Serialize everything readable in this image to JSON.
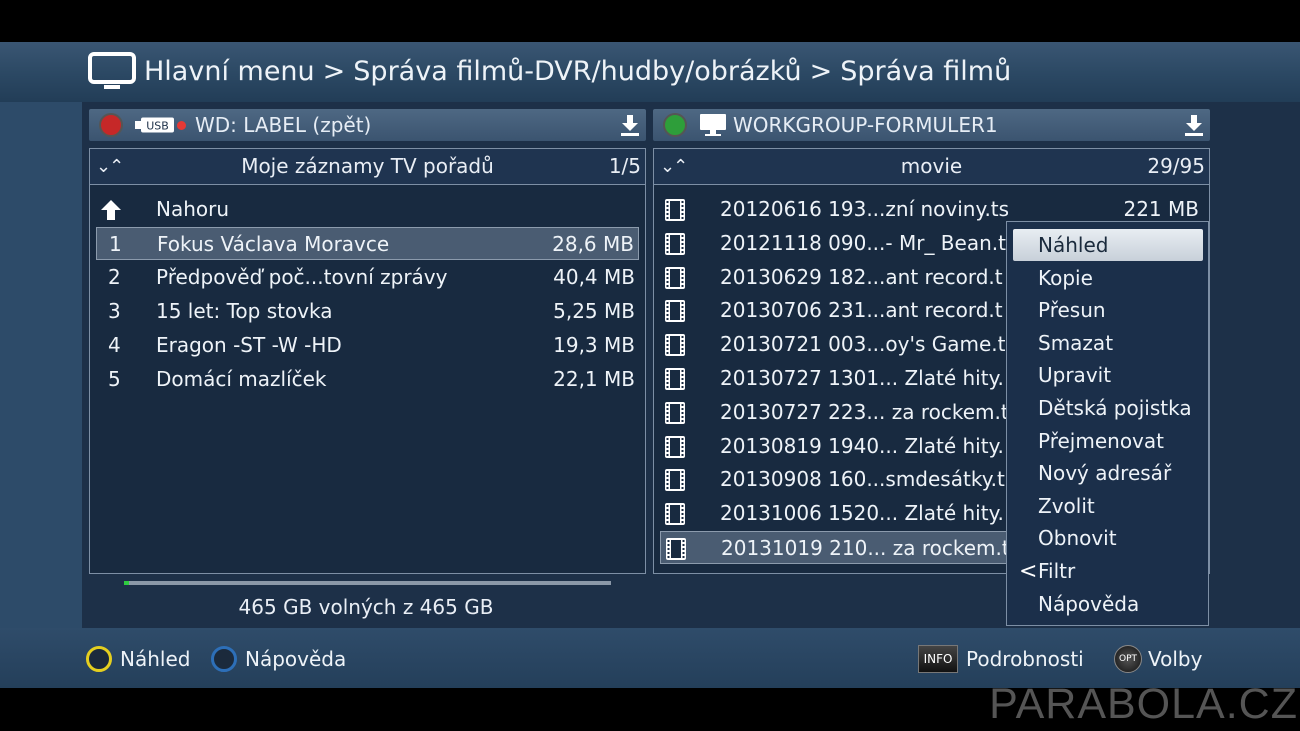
{
  "header": {
    "crumbs": [
      "Hlavní menu",
      "Správa filmů-DVR/hudby/obrázků",
      "Správa filmů"
    ],
    "separator": ">",
    "icon": "tv-icon"
  },
  "left_panel": {
    "device_badge": "USB",
    "title": "WD: LABEL (zpět)",
    "folder": "Moje záznamy TV pořadů",
    "position": "1/5",
    "up_label": "Nahoru",
    "items": [
      {
        "num": "1",
        "name": "Fokus Václava Moravce",
        "size": "28,6 MB"
      },
      {
        "num": "2",
        "name": "Předpověď poč...tovní zprávy",
        "size": "40,4 MB"
      },
      {
        "num": "3",
        "name": "15 let: Top stovka",
        "size": "5,25 MB"
      },
      {
        "num": "4",
        "name": "Eragon -ST -W -HD",
        "size": "19,3 MB"
      },
      {
        "num": "5",
        "name": "Domácí mazlíček",
        "size": "22,1 MB"
      }
    ]
  },
  "right_panel": {
    "title": "WORKGROUP-FORMULER1",
    "folder": "movie",
    "position": "29/95",
    "items": [
      {
        "name": "20120616 193...zní noviny.ts",
        "size": "221 MB"
      },
      {
        "name": "20121118 090...- Mr_ Bean.t"
      },
      {
        "name": "20130629 182...ant record.t"
      },
      {
        "name": "20130706 231...ant record.t"
      },
      {
        "name": "20130721 003...oy's Game.t"
      },
      {
        "name": "20130727 1301... Zlaté hity."
      },
      {
        "name": "20130727 223... za rockem.t"
      },
      {
        "name": "20130819 1940... Zlaté hity."
      },
      {
        "name": "20130908 160...smdesátky.t"
      },
      {
        "name": "20131006 1520... Zlaté hity."
      },
      {
        "name": "20131019 210... za rockem.t"
      }
    ]
  },
  "context_menu": {
    "items": [
      "Náhled",
      "Kopie",
      "Přesun",
      "Smazat",
      "Upravit",
      "Dětská pojistka",
      "Přejmenovat",
      "Nový adresář",
      "Zvolit",
      "Obnovit",
      "Filtr",
      "Nápověda"
    ],
    "selected": "Náhled",
    "submenu_marker": "<"
  },
  "storage": {
    "text": "465 GB volných z 465 GB",
    "used_fraction": 0.01
  },
  "footer": {
    "yellow_label": "Náhled",
    "blue_label": "Nápověda",
    "info_key": "INFO",
    "info_label": "Podrobnosti",
    "opt_key": "OPT",
    "opt_label": "Volby"
  },
  "watermark": "PARABOLA.CZ",
  "colors": {
    "red_button": "#c62828",
    "green_button": "#2e9e3a",
    "yellow_button": "#e5cf1f",
    "blue_button": "#2d6fb8",
    "progress": "#2ecc40"
  }
}
